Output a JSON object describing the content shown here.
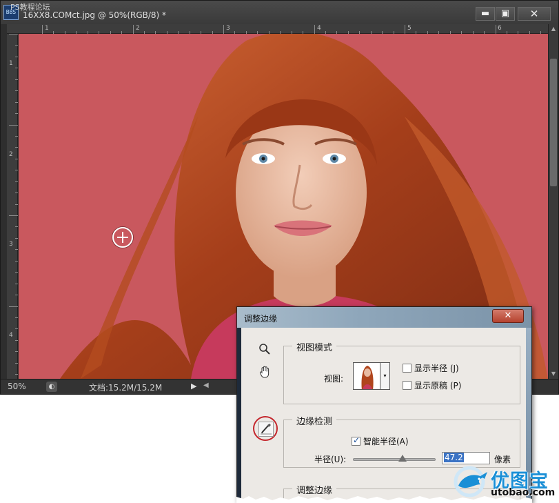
{
  "window": {
    "watermark": "PS教程论坛",
    "logo_text": "BBS",
    "title": "16XX8.COMct.jpg @ 50%(RGB/8) *",
    "minimize_label": "▬",
    "maximize_label": "▣",
    "close_label": "✕"
  },
  "rulers": {
    "h_labels": [
      "1",
      "2",
      "3",
      "4",
      "5",
      "6"
    ],
    "v_labels": [
      "1",
      "2",
      "3",
      "4"
    ]
  },
  "status": {
    "zoom": "50%",
    "doc_info": "文档:15.2M/15.2M",
    "arrow": "▶",
    "scroll_left": "◀"
  },
  "dialog": {
    "title": "调整边缘",
    "close_label": "✕",
    "view_mode": {
      "group_label": "视图模式",
      "view_label": "视图:",
      "dropdown_glyph": "▾",
      "show_radius": "显示半径 (J)",
      "show_original": "显示原稿 (P)",
      "show_radius_checked": false,
      "show_original_checked": false
    },
    "edge_detection": {
      "group_label": "边缘检测",
      "smart_radius": "智能半径(A)",
      "smart_radius_checked": true,
      "radius_label": "半径(U):",
      "radius_value": "47.2",
      "radius_unit": "像素",
      "radius_fraction": 0.6
    },
    "adjust_edge": {
      "group_label": "调整边缘"
    }
  },
  "brand_watermark": {
    "name": "优图宝",
    "url": "utobao.com"
  },
  "colors": {
    "canvas_background": "#c9585e",
    "hair": "#b0451d",
    "accent_red": "#c4262c",
    "watermark_blue": "#1a8fd6"
  },
  "icons": {
    "zoom_tool": "zoom-icon",
    "hand_tool": "hand-icon",
    "refine_radius_tool": "refine-radius-brush-icon"
  }
}
